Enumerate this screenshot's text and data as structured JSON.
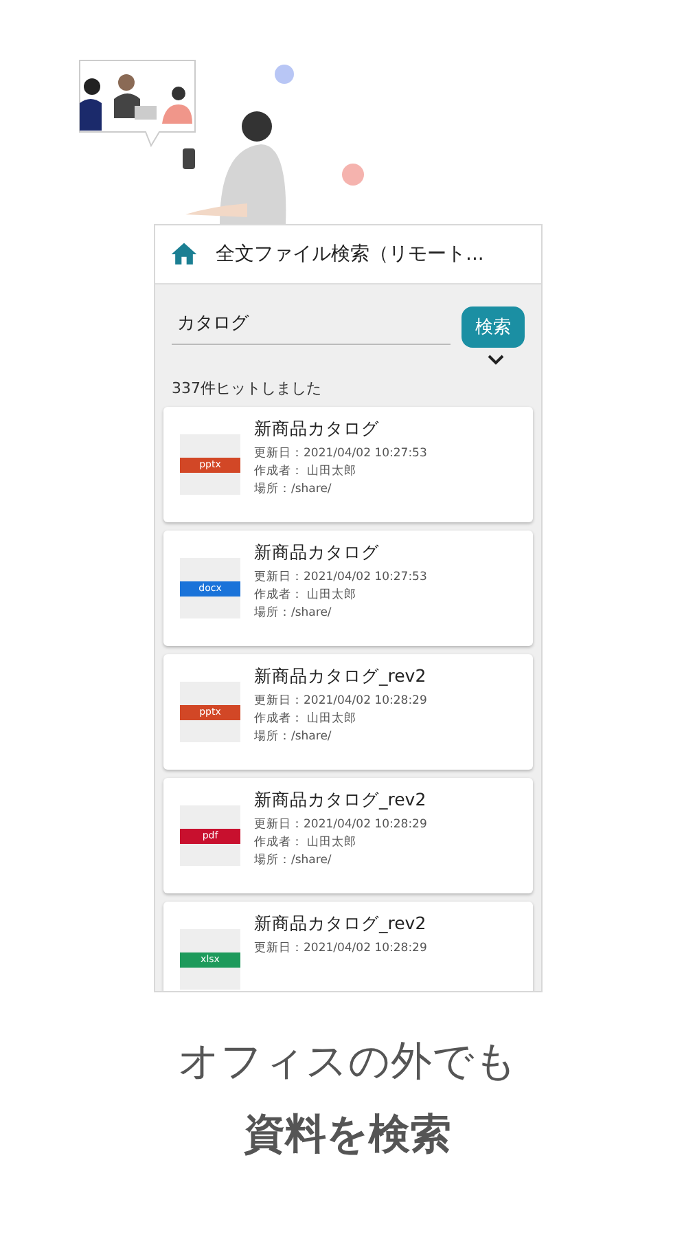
{
  "app_bar": {
    "title": "全文ファイル検索（リモート..."
  },
  "search": {
    "value": "カタログ",
    "button": "検索"
  },
  "result_count": "337件ヒットしました",
  "results": [
    {
      "title": "新商品カタログ",
      "file_type": "pptx",
      "color": "#d24726",
      "meta": [
        "更新日：2021/04/02 10:27:53",
        "作成者： 山田太郎",
        "場所：/share/"
      ]
    },
    {
      "title": "新商品カタログ",
      "file_type": "docx",
      "color": "#1a73d9",
      "meta": [
        "更新日：2021/04/02 10:27:53",
        "作成者： 山田太郎",
        "場所：/share/"
      ]
    },
    {
      "title": "新商品カタログ_rev2",
      "file_type": "pptx",
      "color": "#d24726",
      "meta": [
        "更新日：2021/04/02 10:28:29",
        "作成者： 山田太郎",
        "場所：/share/"
      ]
    },
    {
      "title": "新商品カタログ_rev2",
      "file_type": "pdf",
      "color": "#c8102e",
      "meta": [
        "更新日：2021/04/02 10:28:29",
        "作成者： 山田太郎",
        "場所：/share/"
      ]
    },
    {
      "title": "新商品カタログ_rev2",
      "file_type": "xlsx",
      "color": "#1d9a5b",
      "meta": [
        "更新日：2021/04/02 10:28:29"
      ]
    }
  ],
  "caption": [
    "オフィスの外でも",
    "資料を検索"
  ]
}
